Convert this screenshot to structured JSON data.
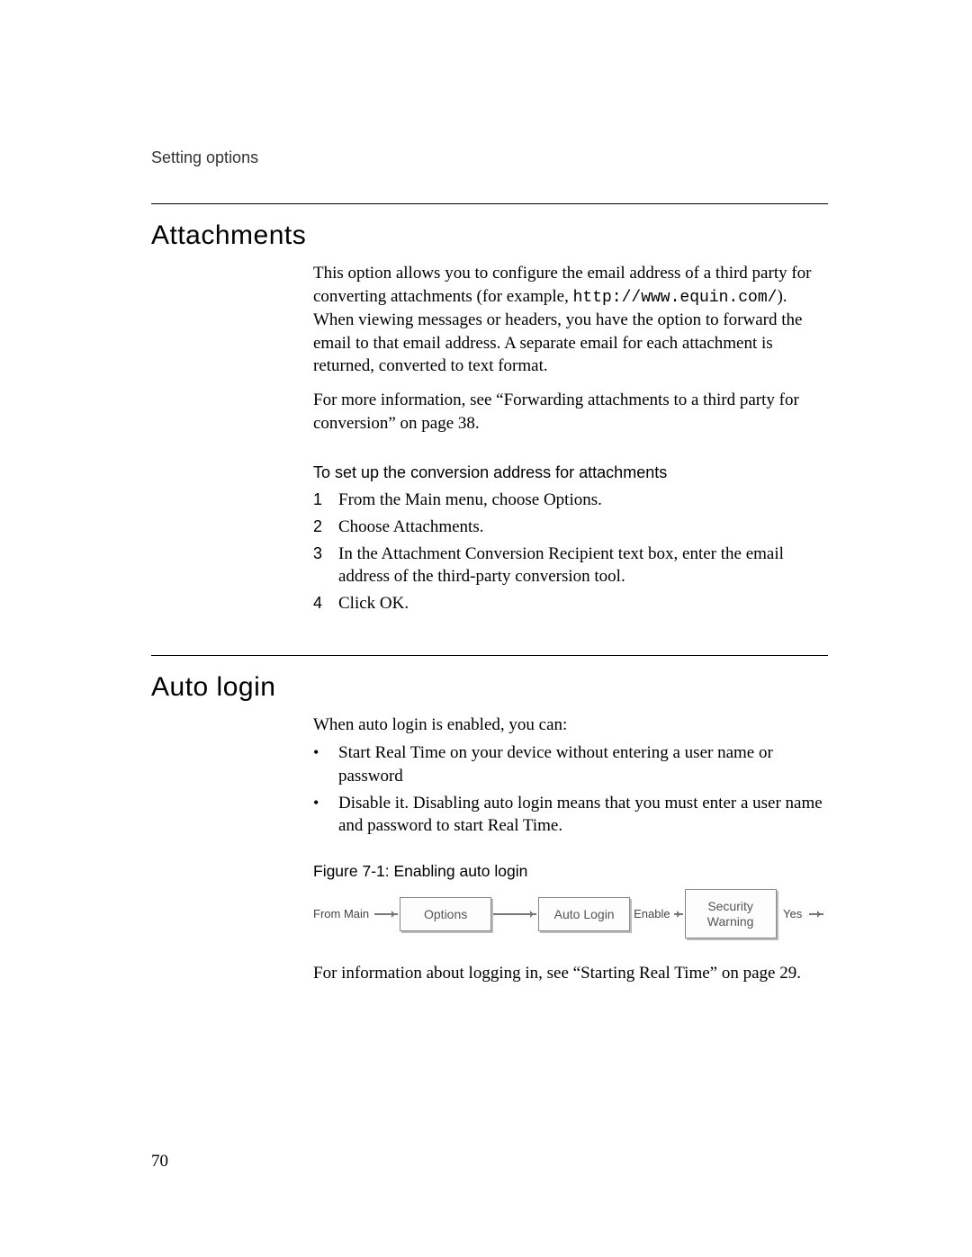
{
  "header": {
    "running": "Setting options"
  },
  "sections": {
    "attachments": {
      "heading": "Attachments",
      "intro_a": "This option allows you to configure the email address of a third party for converting attachments (for example, ",
      "intro_url": "http://www.equin.com/",
      "intro_b": "). When viewing messages or headers, you have the option to forward the email to that email address. A separate email for each attachment is returned, converted to text format.",
      "more_info": "For more information, see “Forwarding attachments to a third party for conversion” on page 38.",
      "task_label": "To set up the conversion address for attachments",
      "steps": [
        {
          "n": "1",
          "t": "From the Main menu, choose Options."
        },
        {
          "n": "2",
          "t": "Choose Attachments."
        },
        {
          "n": "3",
          "t": "In the Attachment Conversion Recipient text box, enter the email address of the third-party conversion tool."
        },
        {
          "n": "4",
          "t": "Click OK."
        }
      ]
    },
    "autologin": {
      "heading": "Auto login",
      "intro": "When auto login is enabled, you can:",
      "bullets": [
        "Start Real Time on your device without entering a user name or password",
        "Disable it. Disabling auto login means that you must enter a user name and password to start Real Time."
      ],
      "figure_caption": "Figure 7-1: Enabling auto login",
      "flow": {
        "from_label": "From Main",
        "b1": "Options",
        "b2": "Auto Login",
        "enable_label": "Enable",
        "b3_line1": "Security",
        "b3_line2": "Warning",
        "yes_label": "Yes"
      },
      "closing": "For information about logging in, see “Starting Real Time” on page 29."
    }
  },
  "page_number": "70"
}
